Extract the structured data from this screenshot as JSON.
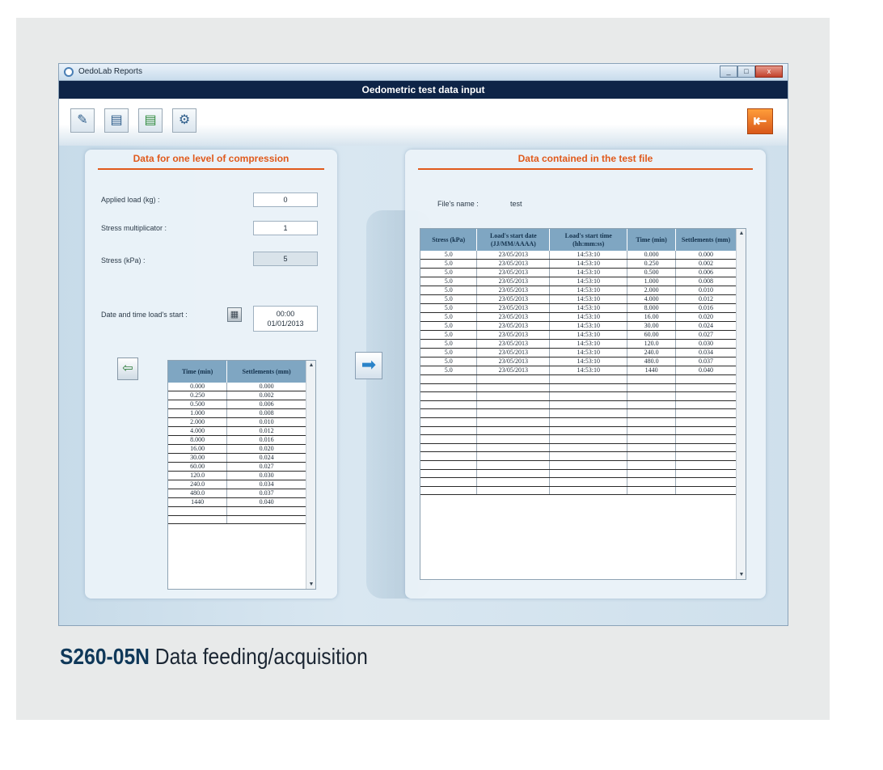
{
  "window": {
    "app_title": "OedoLab Reports",
    "header_title": "Oedometric test data input",
    "controls": {
      "minimize": "_",
      "maximize": "□",
      "close": "x"
    }
  },
  "toolbar": {
    "buttons": [
      {
        "icon": "edit-icon",
        "glyph": "✎"
      },
      {
        "icon": "document-icon",
        "glyph": "▤"
      },
      {
        "icon": "save-icon",
        "glyph": "▤"
      },
      {
        "icon": "settings-gear-icon",
        "glyph": "⚙"
      }
    ],
    "exit": {
      "icon": "exit-door-icon",
      "glyph": "⇤"
    }
  },
  "left_panel": {
    "title": "Data for one level of compression",
    "applied_load": {
      "label": "Applied load (kg) :",
      "value": "0"
    },
    "stress_multiplicator": {
      "label": "Stress multiplicator :",
      "value": "1"
    },
    "stress": {
      "label": "Stress (kPa) :",
      "value": "5"
    },
    "date_start": {
      "label": "Date and time load's start :",
      "time": "00:00",
      "date": "01/01/2013"
    },
    "table": {
      "headers": [
        "Time (min)",
        "Settlements (mm)"
      ],
      "rows": [
        [
          "0.000",
          "0.000"
        ],
        [
          "0.250",
          "0.002"
        ],
        [
          "0.500",
          "0.006"
        ],
        [
          "1.000",
          "0.008"
        ],
        [
          "2.000",
          "0.010"
        ],
        [
          "4.000",
          "0.012"
        ],
        [
          "8.000",
          "0.016"
        ],
        [
          "16.00",
          "0.020"
        ],
        [
          "30.00",
          "0.024"
        ],
        [
          "60.00",
          "0.027"
        ],
        [
          "120.0",
          "0.030"
        ],
        [
          "240.0",
          "0.034"
        ],
        [
          "480.0",
          "0.037"
        ],
        [
          "1440",
          "0.040"
        ],
        [
          "",
          ""
        ],
        [
          "",
          ""
        ]
      ]
    }
  },
  "right_panel": {
    "title": "Data contained in the test file",
    "file_label": "File's name :",
    "file_name": "test",
    "table": {
      "headers": [
        "Stress (kPa)",
        "Load's start date (JJ/MM/AAAA)",
        "Load's start time (hh:mm:ss)",
        "Time (min)",
        "Settlements (mm)"
      ],
      "rows": [
        [
          "5.0",
          "23/05/2013",
          "14:53:10",
          "0.000",
          "0.000"
        ],
        [
          "5.0",
          "23/05/2013",
          "14:53:10",
          "0.250",
          "0.002"
        ],
        [
          "5.0",
          "23/05/2013",
          "14:53:10",
          "0.500",
          "0.006"
        ],
        [
          "5.0",
          "23/05/2013",
          "14:53:10",
          "1.000",
          "0.008"
        ],
        [
          "5.0",
          "23/05/2013",
          "14:53:10",
          "2.000",
          "0.010"
        ],
        [
          "5.0",
          "23/05/2013",
          "14:53:10",
          "4.000",
          "0.012"
        ],
        [
          "5.0",
          "23/05/2013",
          "14:53:10",
          "8.000",
          "0.016"
        ],
        [
          "5.0",
          "23/05/2013",
          "14:53:10",
          "16.00",
          "0.020"
        ],
        [
          "5.0",
          "23/05/2013",
          "14:53:10",
          "30.00",
          "0.024"
        ],
        [
          "5.0",
          "23/05/2013",
          "14:53:10",
          "60.00",
          "0.027"
        ],
        [
          "5.0",
          "23/05/2013",
          "14:53:10",
          "120.0",
          "0.030"
        ],
        [
          "5.0",
          "23/05/2013",
          "14:53:10",
          "240.0",
          "0.034"
        ],
        [
          "5.0",
          "23/05/2013",
          "14:53:10",
          "480.0",
          "0.037"
        ],
        [
          "5.0",
          "23/05/2013",
          "14:53:10",
          "1440",
          "0.040"
        ],
        [
          "",
          "",
          "",
          "",
          ""
        ],
        [
          "",
          "",
          "",
          "",
          ""
        ],
        [
          "",
          "",
          "",
          "",
          ""
        ],
        [
          "",
          "",
          "",
          "",
          ""
        ],
        [
          "",
          "",
          "",
          "",
          ""
        ],
        [
          "",
          "",
          "",
          "",
          ""
        ],
        [
          "",
          "",
          "",
          "",
          ""
        ],
        [
          "",
          "",
          "",
          "",
          ""
        ],
        [
          "",
          "",
          "",
          "",
          ""
        ],
        [
          "",
          "",
          "",
          "",
          ""
        ],
        [
          "",
          "",
          "",
          "",
          ""
        ],
        [
          "",
          "",
          "",
          "",
          ""
        ],
        [
          "",
          "",
          "",
          "",
          ""
        ],
        [
          "",
          "",
          "",
          "",
          ""
        ]
      ]
    }
  },
  "caption": {
    "code": "S260-05N",
    "text": "Data feeding/acquisition"
  },
  "colors": {
    "header_bar": "#0e2447",
    "accent_orange": "#e05a1c",
    "grid_header": "#7fa6c2"
  }
}
